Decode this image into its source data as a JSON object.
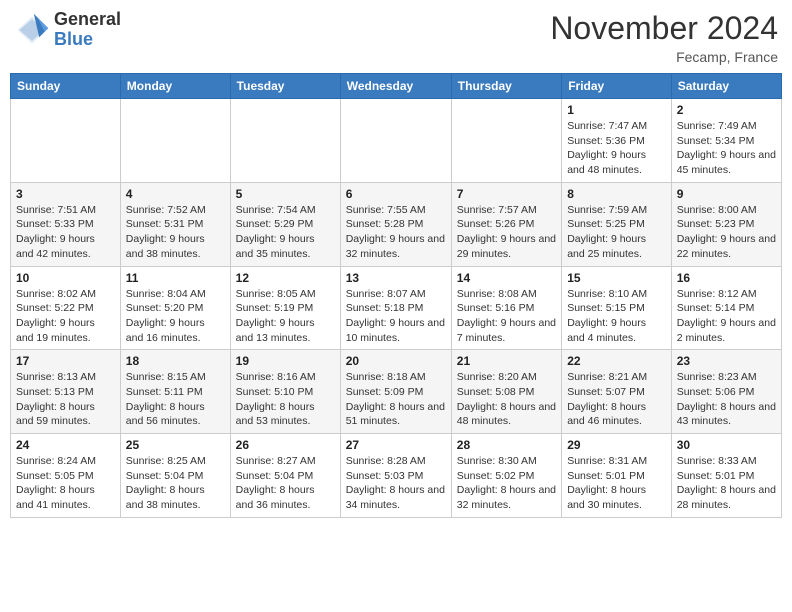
{
  "header": {
    "logo_general": "General",
    "logo_blue": "Blue",
    "month_title": "November 2024",
    "location": "Fecamp, France"
  },
  "weekdays": [
    "Sunday",
    "Monday",
    "Tuesday",
    "Wednesday",
    "Thursday",
    "Friday",
    "Saturday"
  ],
  "weeks": [
    [
      {
        "day": "",
        "info": ""
      },
      {
        "day": "",
        "info": ""
      },
      {
        "day": "",
        "info": ""
      },
      {
        "day": "",
        "info": ""
      },
      {
        "day": "",
        "info": ""
      },
      {
        "day": "1",
        "info": "Sunrise: 7:47 AM\nSunset: 5:36 PM\nDaylight: 9 hours and 48 minutes."
      },
      {
        "day": "2",
        "info": "Sunrise: 7:49 AM\nSunset: 5:34 PM\nDaylight: 9 hours and 45 minutes."
      }
    ],
    [
      {
        "day": "3",
        "info": "Sunrise: 7:51 AM\nSunset: 5:33 PM\nDaylight: 9 hours and 42 minutes."
      },
      {
        "day": "4",
        "info": "Sunrise: 7:52 AM\nSunset: 5:31 PM\nDaylight: 9 hours and 38 minutes."
      },
      {
        "day": "5",
        "info": "Sunrise: 7:54 AM\nSunset: 5:29 PM\nDaylight: 9 hours and 35 minutes."
      },
      {
        "day": "6",
        "info": "Sunrise: 7:55 AM\nSunset: 5:28 PM\nDaylight: 9 hours and 32 minutes."
      },
      {
        "day": "7",
        "info": "Sunrise: 7:57 AM\nSunset: 5:26 PM\nDaylight: 9 hours and 29 minutes."
      },
      {
        "day": "8",
        "info": "Sunrise: 7:59 AM\nSunset: 5:25 PM\nDaylight: 9 hours and 25 minutes."
      },
      {
        "day": "9",
        "info": "Sunrise: 8:00 AM\nSunset: 5:23 PM\nDaylight: 9 hours and 22 minutes."
      }
    ],
    [
      {
        "day": "10",
        "info": "Sunrise: 8:02 AM\nSunset: 5:22 PM\nDaylight: 9 hours and 19 minutes."
      },
      {
        "day": "11",
        "info": "Sunrise: 8:04 AM\nSunset: 5:20 PM\nDaylight: 9 hours and 16 minutes."
      },
      {
        "day": "12",
        "info": "Sunrise: 8:05 AM\nSunset: 5:19 PM\nDaylight: 9 hours and 13 minutes."
      },
      {
        "day": "13",
        "info": "Sunrise: 8:07 AM\nSunset: 5:18 PM\nDaylight: 9 hours and 10 minutes."
      },
      {
        "day": "14",
        "info": "Sunrise: 8:08 AM\nSunset: 5:16 PM\nDaylight: 9 hours and 7 minutes."
      },
      {
        "day": "15",
        "info": "Sunrise: 8:10 AM\nSunset: 5:15 PM\nDaylight: 9 hours and 4 minutes."
      },
      {
        "day": "16",
        "info": "Sunrise: 8:12 AM\nSunset: 5:14 PM\nDaylight: 9 hours and 2 minutes."
      }
    ],
    [
      {
        "day": "17",
        "info": "Sunrise: 8:13 AM\nSunset: 5:13 PM\nDaylight: 8 hours and 59 minutes."
      },
      {
        "day": "18",
        "info": "Sunrise: 8:15 AM\nSunset: 5:11 PM\nDaylight: 8 hours and 56 minutes."
      },
      {
        "day": "19",
        "info": "Sunrise: 8:16 AM\nSunset: 5:10 PM\nDaylight: 8 hours and 53 minutes."
      },
      {
        "day": "20",
        "info": "Sunrise: 8:18 AM\nSunset: 5:09 PM\nDaylight: 8 hours and 51 minutes."
      },
      {
        "day": "21",
        "info": "Sunrise: 8:20 AM\nSunset: 5:08 PM\nDaylight: 8 hours and 48 minutes."
      },
      {
        "day": "22",
        "info": "Sunrise: 8:21 AM\nSunset: 5:07 PM\nDaylight: 8 hours and 46 minutes."
      },
      {
        "day": "23",
        "info": "Sunrise: 8:23 AM\nSunset: 5:06 PM\nDaylight: 8 hours and 43 minutes."
      }
    ],
    [
      {
        "day": "24",
        "info": "Sunrise: 8:24 AM\nSunset: 5:05 PM\nDaylight: 8 hours and 41 minutes."
      },
      {
        "day": "25",
        "info": "Sunrise: 8:25 AM\nSunset: 5:04 PM\nDaylight: 8 hours and 38 minutes."
      },
      {
        "day": "26",
        "info": "Sunrise: 8:27 AM\nSunset: 5:04 PM\nDaylight: 8 hours and 36 minutes."
      },
      {
        "day": "27",
        "info": "Sunrise: 8:28 AM\nSunset: 5:03 PM\nDaylight: 8 hours and 34 minutes."
      },
      {
        "day": "28",
        "info": "Sunrise: 8:30 AM\nSunset: 5:02 PM\nDaylight: 8 hours and 32 minutes."
      },
      {
        "day": "29",
        "info": "Sunrise: 8:31 AM\nSunset: 5:01 PM\nDaylight: 8 hours and 30 minutes."
      },
      {
        "day": "30",
        "info": "Sunrise: 8:33 AM\nSunset: 5:01 PM\nDaylight: 8 hours and 28 minutes."
      }
    ]
  ]
}
